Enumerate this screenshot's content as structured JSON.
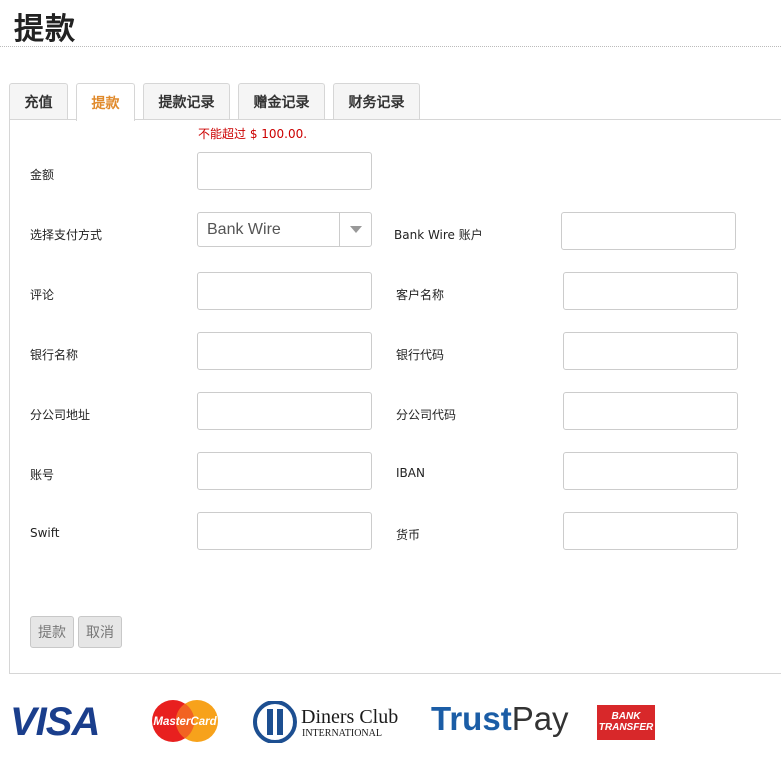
{
  "page": {
    "title": "提款"
  },
  "tabs": [
    {
      "label": "充值",
      "active": false
    },
    {
      "label": "提款",
      "active": true
    },
    {
      "label": "提款记录",
      "active": false
    },
    {
      "label": "赠金记录",
      "active": false
    },
    {
      "label": "财务记录",
      "active": false
    }
  ],
  "form": {
    "limit_note": "不能超过 $ 100.00.",
    "amount_label": "金额",
    "payment_method_label": "选择支付方式",
    "payment_method_value": "Bank Wire",
    "bank_wire_account_label": "Bank Wire 账户",
    "comment_label": "评论",
    "customer_name_label": "客户名称",
    "bank_name_label": "银行名称",
    "bank_code_label": "银行代码",
    "branch_address_label": "分公司地址",
    "branch_code_label": "分公司代码",
    "account_number_label": "账号",
    "iban_label": "IBAN",
    "swift_label": "Swift",
    "currency_label": "货币"
  },
  "buttons": {
    "submit": "提款",
    "cancel": "取消"
  },
  "logos": {
    "visa": "VISA",
    "mastercard": "MasterCard",
    "diners_line1": "Diners Club",
    "diners_line2": "INTERNATIONAL",
    "trustpay_1": "Trust",
    "trustpay_2": "Pay",
    "bank_transfer_1": "BANK",
    "bank_transfer_2": "TRANSFER"
  },
  "colors": {
    "active_tab": "#e08a2c",
    "limit_note": "#cc0000",
    "visa_blue": "#1a3e8c",
    "bank_red": "#d8282a"
  }
}
